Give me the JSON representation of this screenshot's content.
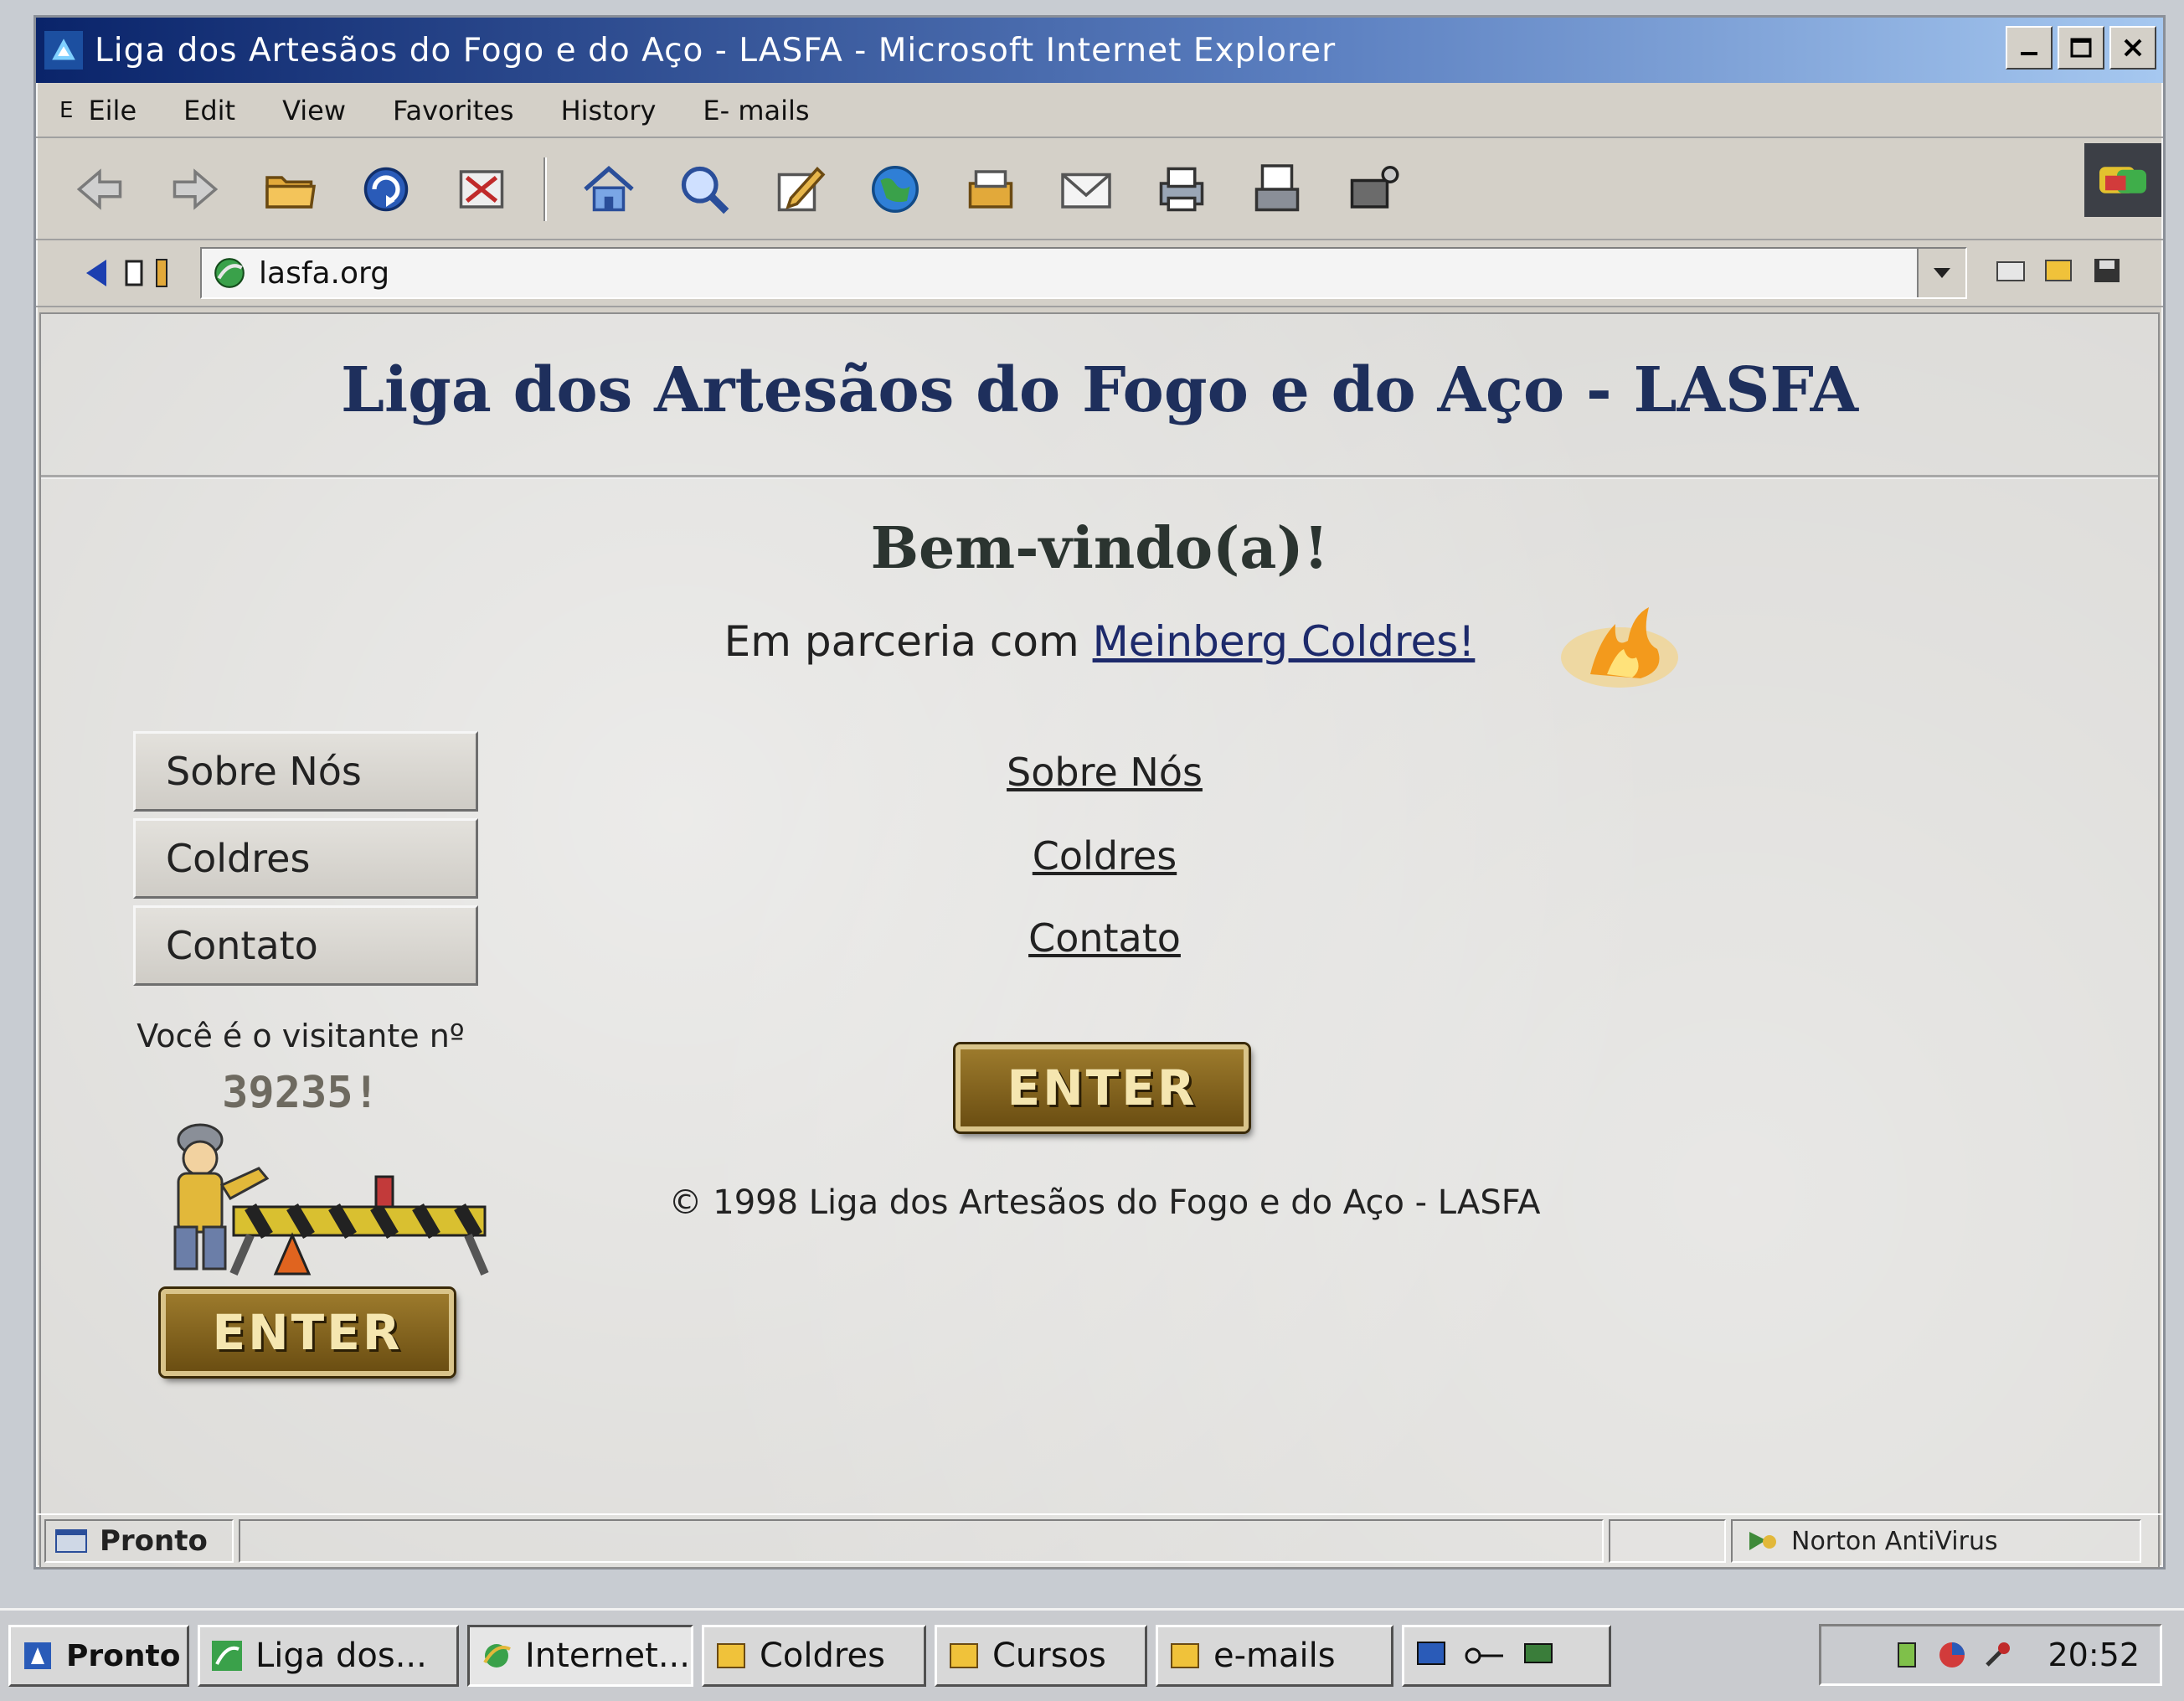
{
  "window": {
    "title": "Liga dos Artesãos do Fogo e do Aço - LASFA - Microsoft Internet Explorer",
    "controls": [
      "minimize-icon",
      "maximize-icon",
      "close-icon"
    ]
  },
  "menu": {
    "items": [
      "Eile",
      "Edit",
      "View",
      "Favorites",
      "History",
      "E- mails"
    ],
    "leading_glyph": "E"
  },
  "toolbar": {
    "icons": [
      "back-icon",
      "forward-icon",
      "open-folder-icon",
      "refresh-icon",
      "stop-icon",
      "home-icon",
      "search-icon",
      "edit-icon",
      "globe-icon",
      "print-tray-icon",
      "mail-icon",
      "print-icon",
      "document-icon",
      "tools-icon"
    ]
  },
  "address": {
    "url": "lasfa.org"
  },
  "page": {
    "site_title": "Liga dos Artesãos do Fogo e do Aço - LASFA",
    "welcome": "Bem-vindo(a)!",
    "partner_prefix": "Em parceria com ",
    "partner_link": "Meinberg Coldres!",
    "nav_buttons": [
      "Sobre Nós",
      "Coldres",
      "Contato"
    ],
    "text_links": [
      "Sobre Nós",
      "Coldres",
      "Contato"
    ],
    "visitor_label": "Você é o visitante nº",
    "visitor_count": "39235!",
    "enter_label": "ENTER",
    "copyright": "© 1998 Liga dos Artesãos do Fogo e do Aço - LASFA"
  },
  "status": {
    "text": "Pronto",
    "antivirus": "Norton AntiVirus"
  },
  "taskbar": {
    "start": "Pronto",
    "tasks": [
      "Liga dos...",
      "Internet...",
      "Coldres",
      "Cursos",
      "e-mails"
    ],
    "clock": "20:52"
  },
  "colors": {
    "title_bar": "#0a246a",
    "site_title": "#1e2f5c",
    "link": "#1d2a6b",
    "enter_button": "#8a6a20"
  }
}
